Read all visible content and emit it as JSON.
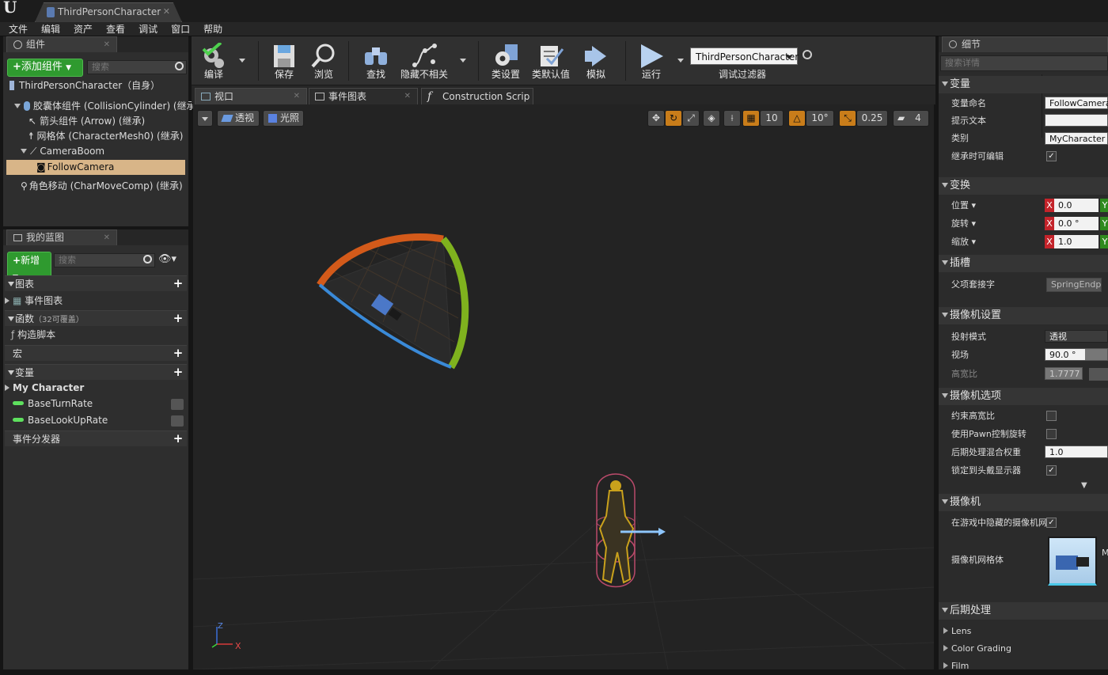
{
  "window": {
    "logo": "U",
    "doc_tab": "ThirdPersonCharacter"
  },
  "menu": [
    "文件",
    "编辑",
    "资产",
    "查看",
    "调试",
    "窗口",
    "帮助"
  ],
  "components": {
    "tab": "组件",
    "add_button": "添加组件",
    "search_placeholder": "搜索",
    "root": "ThirdPersonCharacter（自身）",
    "items": [
      "胶囊体组件 (CollisionCylinder) (继承)",
      "箭头组件 (Arrow) (继承)",
      "网格体 (CharacterMesh0) (继承)",
      "CameraBoom",
      "FollowCamera",
      "角色移动 (CharMoveComp) (继承)"
    ]
  },
  "blueprint": {
    "tab": "我的蓝图",
    "new_button": "新增",
    "search_placeholder": "搜索",
    "graphs": "图表",
    "event_graph": "事件图表",
    "functions": "函数",
    "functions_note": "（32可覆盖）",
    "construction": "构造脚本",
    "macros": "宏",
    "variables": "变量",
    "category": "My Character",
    "vars": [
      "BaseTurnRate",
      "BaseLookUpRate"
    ],
    "dispatchers": "事件分发器"
  },
  "toolbar": {
    "compile": "编译",
    "save": "保存",
    "browse": "浏览",
    "find": "查找",
    "hide": "隐藏不相关",
    "class_settings": "类设置",
    "class_defaults": "类默认值",
    "simulate": "模拟",
    "play": "运行",
    "debug_object": "ThirdPersonCharacter",
    "debug_filter": "调试过滤器"
  },
  "tabs": {
    "viewport": "视口",
    "event_graph": "事件图表",
    "construction": "Construction Scrip",
    "func_glyph": "f"
  },
  "viewport": {
    "perspective": "透视",
    "lit": "光照",
    "grid_snap": "10",
    "rot_snap": "10°",
    "scale_snap": "0.25",
    "cam_speed": "4",
    "axis_x": "X",
    "axis_z": "Z"
  },
  "details": {
    "tab": "细节",
    "search_placeholder": "搜索详情",
    "sec_variable": "变量",
    "var_name_k": "变量命名",
    "var_name_v": "FollowCamera",
    "tooltip_k": "提示文本",
    "category_k": "类别",
    "category_v": "MyCharacter",
    "editable_k": "继承时可编辑",
    "sec_transform": "变换",
    "location_k": "位置",
    "rotation_k": "旋转",
    "scale_k": "缩放",
    "loc_x": "0.0",
    "rot_x": "0.0 °",
    "scale_x": "1.0",
    "x": "X",
    "y": "Y",
    "sec_socket": "插槽",
    "parent_socket_k": "父项套接字",
    "parent_socket_v": "SpringEndpoir",
    "sec_camera_settings": "摄像机设置",
    "projection_k": "投射模式",
    "projection_v": "透视",
    "fov_k": "视场",
    "fov_v": "90.0 °",
    "aspect_k": "高宽比",
    "aspect_v": "1.7777",
    "sec_camera_options": "摄像机选项",
    "constrain_k": "约束高宽比",
    "pawn_rot_k": "使用Pawn控制旋转",
    "pp_weight_k": "后期处理混合权重",
    "pp_weight_v": "1.0",
    "lock_hmd_k": "锁定到头戴显示器",
    "sec_camera": "摄像机",
    "hide_mesh_k": "在游戏中隐藏的摄像机网",
    "camera_mesh_k": "摄像机网格体",
    "mesh_letter": "M",
    "sec_postprocess": "后期处理",
    "lens": "Lens",
    "color_grading": "Color Grading",
    "film": "Film",
    "check": "✓"
  }
}
